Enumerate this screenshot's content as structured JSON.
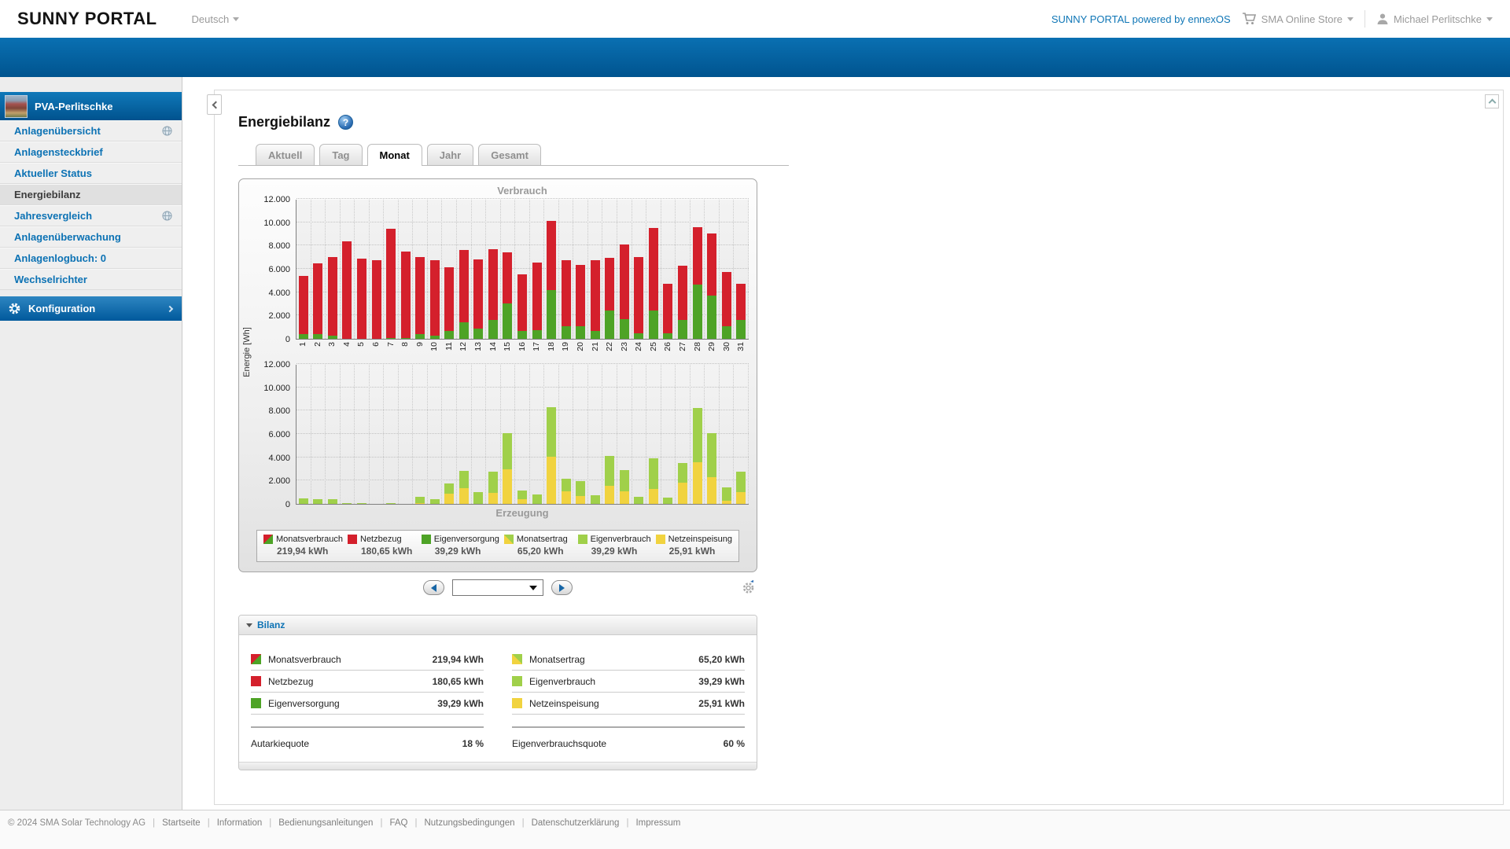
{
  "header": {
    "logo": "SUNNY PORTAL",
    "language": "Deutsch",
    "powered": "SUNNY PORTAL powered by ennexOS",
    "store": "SMA Online Store",
    "user": "Michael Perlitschke"
  },
  "sidebar": {
    "plant": "PVA-Perlitschke",
    "items": [
      {
        "label": "Anlagenübersicht",
        "globe": true,
        "active": false
      },
      {
        "label": "Anlagensteckbrief",
        "globe": false,
        "active": false
      },
      {
        "label": "Aktueller Status",
        "globe": false,
        "active": false
      },
      {
        "label": "Energiebilanz",
        "globe": false,
        "active": true
      },
      {
        "label": "Jahresvergleich",
        "globe": true,
        "active": false
      },
      {
        "label": "Anlagenüberwachung",
        "globe": false,
        "active": false
      },
      {
        "label": "Anlagenlogbuch: 0",
        "globe": false,
        "active": false
      },
      {
        "label": "Wechselrichter",
        "globe": false,
        "active": false
      }
    ],
    "config_label": "Konfiguration"
  },
  "page": {
    "title": "Energiebilanz",
    "tabs": [
      {
        "label": "Aktuell",
        "active": false
      },
      {
        "label": "Tag",
        "active": false
      },
      {
        "label": "Monat",
        "active": true
      },
      {
        "label": "Jahr",
        "active": false
      },
      {
        "label": "Gesamt",
        "active": false
      }
    ]
  },
  "chart_data": [
    {
      "type": "bar",
      "stacked": true,
      "title": "Verbrauch",
      "title_position": "top",
      "ylabel": "Energie [Wh]",
      "ylim": [
        0,
        12000
      ],
      "ytick_step": 2000,
      "grid": true,
      "categories": [
        1,
        2,
        3,
        4,
        5,
        6,
        7,
        8,
        9,
        10,
        11,
        12,
        13,
        14,
        15,
        16,
        17,
        18,
        19,
        20,
        21,
        22,
        23,
        24,
        25,
        26,
        27,
        28,
        29,
        30,
        31
      ],
      "series": [
        {
          "name": "Eigenversorgung",
          "color": "#4ea326",
          "values": [
            380,
            380,
            300,
            30,
            30,
            30,
            50,
            50,
            430,
            300,
            700,
            1400,
            850,
            1650,
            3000,
            650,
            750,
            4150,
            1050,
            1050,
            650,
            2450,
            1700,
            450,
            2450,
            450,
            1600,
            4650,
            3700,
            1050,
            1600
          ]
        },
        {
          "name": "Netzbezug",
          "color": "#d4202c",
          "values": [
            5020,
            6070,
            6750,
            8350,
            6870,
            6750,
            9350,
            7400,
            6620,
            6480,
            5450,
            6200,
            5950,
            6100,
            4350,
            4830,
            5800,
            5950,
            5650,
            5250,
            6050,
            4550,
            6400,
            6550,
            7100,
            4250,
            4650,
            4900,
            5300,
            4650,
            3100
          ]
        }
      ]
    },
    {
      "type": "bar",
      "stacked": true,
      "title": "Erzeugung",
      "title_position": "bottom",
      "ylabel": "Energie [Wh]",
      "ylim": [
        0,
        12000
      ],
      "ytick_step": 2000,
      "grid": true,
      "categories": [
        1,
        2,
        3,
        4,
        5,
        6,
        7,
        8,
        9,
        10,
        11,
        12,
        13,
        14,
        15,
        16,
        17,
        18,
        19,
        20,
        21,
        22,
        23,
        24,
        25,
        26,
        27,
        28,
        29,
        30,
        31
      ],
      "series": [
        {
          "name": "Netzeinspeisung",
          "color": "#f1d33f",
          "values": [
            0,
            0,
            0,
            0,
            0,
            0,
            0,
            30,
            80,
            0,
            850,
            1350,
            30,
            950,
            2950,
            380,
            0,
            4050,
            1050,
            650,
            30,
            1550,
            1050,
            0,
            1250,
            30,
            1850,
            3550,
            2300,
            250,
            1000
          ]
        },
        {
          "name": "Eigenverbrauch",
          "color": "#a0d04a",
          "values": [
            450,
            420,
            380,
            70,
            80,
            30,
            80,
            0,
            570,
            380,
            900,
            1500,
            1020,
            1800,
            3100,
            770,
            800,
            4250,
            1100,
            1250,
            770,
            2550,
            1800,
            600,
            2600,
            570,
            1700,
            4650,
            3800,
            1150,
            1750
          ]
        }
      ]
    }
  ],
  "legend": {
    "items": [
      {
        "name": "Monatsverbrauch",
        "value": "219,94 kWh",
        "swatch": "red-green"
      },
      {
        "name": "Netzbezug",
        "value": "180,65 kWh",
        "swatch": "red"
      },
      {
        "name": "Eigenversorgung",
        "value": "39,29 kWh",
        "swatch": "green"
      },
      {
        "name": "Monatsertrag",
        "value": "65,20 kWh",
        "swatch": "yellow-lightgreen"
      },
      {
        "name": "Eigenverbrauch",
        "value": "39,29 kWh",
        "swatch": "lightgreen"
      },
      {
        "name": "Netzeinspeisung",
        "value": "25,91 kWh",
        "swatch": "yellow"
      }
    ]
  },
  "bilanz": {
    "title": "Bilanz",
    "left": [
      {
        "swatch": "red-green",
        "label": "Monatsverbrauch",
        "value": "219,94 kWh"
      },
      {
        "swatch": "red",
        "label": "Netzbezug",
        "value": "180,65 kWh"
      },
      {
        "swatch": "green",
        "label": "Eigenversorgung",
        "value": "39,29 kWh"
      }
    ],
    "left_total": {
      "label": "Autarkiequote",
      "value": "18 %"
    },
    "right": [
      {
        "swatch": "yellow-lightgreen",
        "label": "Monatsertrag",
        "value": "65,20 kWh"
      },
      {
        "swatch": "lightgreen",
        "label": "Eigenverbrauch",
        "value": "39,29 kWh"
      },
      {
        "swatch": "yellow",
        "label": "Netzeinspeisung",
        "value": "25,91 kWh"
      }
    ],
    "right_total": {
      "label": "Eigenverbrauchsquote",
      "value": "60 %"
    }
  },
  "colors": {
    "red": "#d4202c",
    "green": "#4ea326",
    "lightgreen": "#a0d04a",
    "yellow": "#f1d33f",
    "accent_blue": "#0c72b4"
  },
  "footer": {
    "copyright": "© 2024 SMA Solar Technology AG",
    "links": [
      "Startseite",
      "Information",
      "Bedienungsanleitungen",
      "FAQ",
      "Nutzungsbedingungen",
      "Datenschutzerklärung",
      "Impressum"
    ]
  }
}
